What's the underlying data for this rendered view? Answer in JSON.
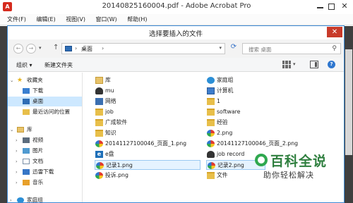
{
  "acrobat": {
    "window_title": "20140825160004.pdf - Adobe Acrobat Pro",
    "menu": [
      "文件(F)",
      "编辑(E)",
      "视图(V)",
      "窗口(W)",
      "帮助(H)"
    ]
  },
  "dialog": {
    "title": "选择要插入的文件",
    "close_glyph": "✕",
    "address": {
      "location": "桌面",
      "separator": "›"
    },
    "search_placeholder": "搜索 桌面",
    "toolbar": {
      "organize": "组织 ▾",
      "new_folder": "新建文件夹"
    },
    "nav_pane": {
      "items": [
        {
          "label": "收藏夹",
          "icon": "star-icon",
          "expandable": true
        },
        {
          "label": "下载",
          "icon": "download-folder-icon"
        },
        {
          "label": "桌面",
          "icon": "desktop-icon",
          "selected": true
        },
        {
          "label": "最近访问的位置",
          "icon": "recent-places-icon"
        },
        {
          "label": "库",
          "icon": "library-icon",
          "expandable": true
        },
        {
          "label": "视频",
          "icon": "video-icon",
          "expandable": true
        },
        {
          "label": "图片",
          "icon": "picture-icon",
          "expandable": true
        },
        {
          "label": "文档",
          "icon": "document-icon",
          "expandable": true
        },
        {
          "label": "迅雷下载",
          "icon": "thunder-icon",
          "expandable": true
        },
        {
          "label": "音乐",
          "icon": "music-icon",
          "expandable": true
        },
        {
          "label": "家庭组",
          "icon": "homegroup-icon",
          "expandable": true
        }
      ]
    },
    "files": {
      "left_column": [
        {
          "name": "库",
          "icon": "library-icon"
        },
        {
          "name": "mu",
          "icon": "user-icon"
        },
        {
          "name": "网络",
          "icon": "network-icon"
        },
        {
          "name": "job",
          "icon": "folder-icon"
        },
        {
          "name": "广成软件",
          "icon": "folder-icon"
        },
        {
          "name": "知识",
          "icon": "folder-icon"
        },
        {
          "name": "20141127100046_页面_1.png",
          "icon": "image-icon"
        },
        {
          "name": "e盘",
          "icon": "shortcut-icon"
        },
        {
          "name": "记录1.png",
          "icon": "image-icon",
          "selected": true
        },
        {
          "name": "投诉.png",
          "icon": "image-icon"
        }
      ],
      "right_column": [
        {
          "name": "家庭组",
          "icon": "homegroup-icon"
        },
        {
          "name": "计算机",
          "icon": "computer-icon"
        },
        {
          "name": "1",
          "icon": "folder-icon"
        },
        {
          "name": "software",
          "icon": "folder-icon"
        },
        {
          "name": "经验",
          "icon": "folder-icon"
        },
        {
          "name": "2.png",
          "icon": "image-icon"
        },
        {
          "name": "20141127100046_页面_2.png",
          "icon": "image-icon"
        },
        {
          "name": "job record",
          "icon": "user-icon"
        },
        {
          "name": "记录2.png",
          "icon": "image-icon",
          "selected": true
        },
        {
          "name": "文件",
          "icon": "folder-icon"
        }
      ]
    }
  },
  "watermark": {
    "title": "百科全说",
    "subtitle": "助你轻松解决"
  }
}
